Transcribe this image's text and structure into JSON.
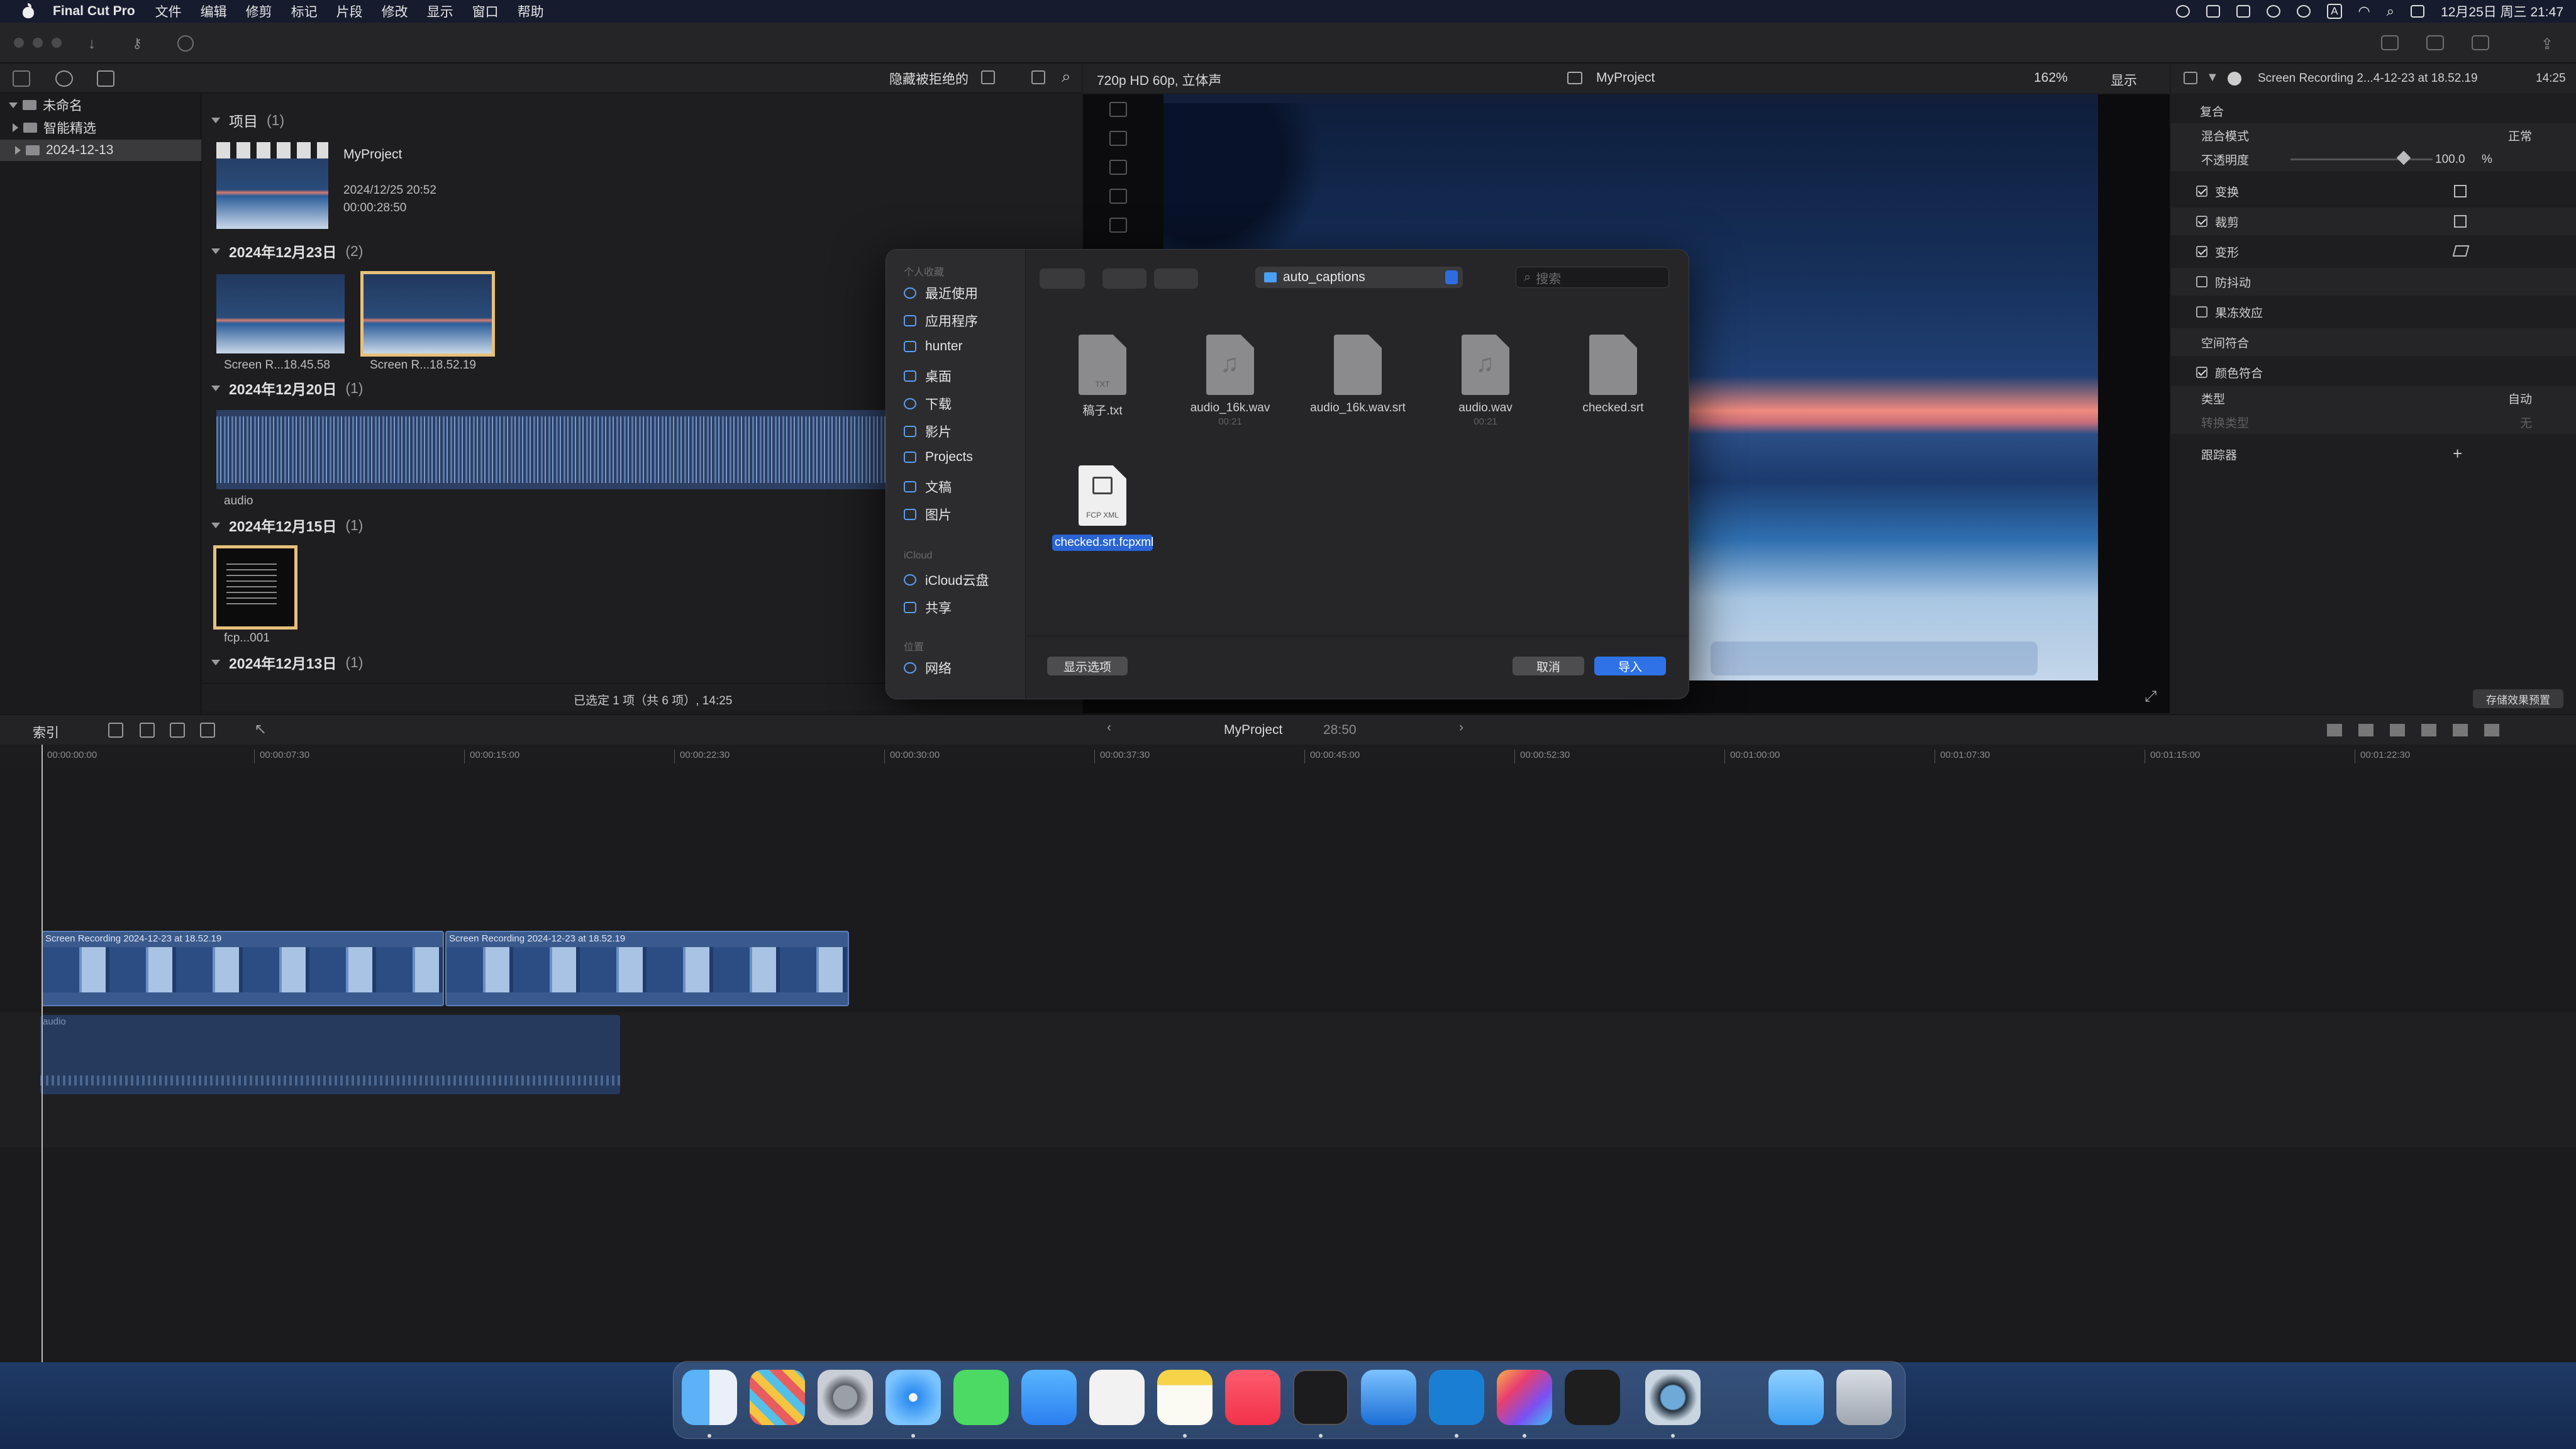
{
  "menubar": {
    "app": "Final Cut Pro",
    "items": [
      "文件",
      "编辑",
      "修剪",
      "标记",
      "片段",
      "修改",
      "显示",
      "窗口",
      "帮助"
    ],
    "datetime": "12月25日 周三 21:47",
    "input_badge": "A"
  },
  "library": {
    "root": "未命名",
    "smart": "智能精选",
    "event": "2024-12-13"
  },
  "browser": {
    "filter_label": "隐藏被拒绝的",
    "projects_header": "项目",
    "projects_count": "(1)",
    "project_name": "MyProject",
    "project_date": "2024/12/25 20:52",
    "project_duration": "00:00:28:50",
    "groups": [
      {
        "title": "2024年12月23日",
        "count": "(2)"
      },
      {
        "title": "2024年12月20日",
        "count": "(1)"
      },
      {
        "title": "2024年12月15日",
        "count": "(1)"
      },
      {
        "title": "2024年12月13日",
        "count": "(1)"
      }
    ],
    "clip1": "Screen R...18.45.58",
    "clip2": "Screen R...18.52.19",
    "audio_clip": "audio",
    "fcp_clip": "fcp...001",
    "footer": "已选定 1 项（共 6 项）, 14:25"
  },
  "viewer": {
    "format": "720p HD 60p, 立体声",
    "project": "MyProject",
    "zoom": "162%",
    "display": "显示"
  },
  "inspector": {
    "title": "Screen Recording 2...4-12-23 at 18.52.19",
    "timecode": "14:25",
    "section": "复合",
    "blend_label": "混合模式",
    "blend_value": "正常",
    "opacity_label": "不透明度",
    "opacity_value": "100.0",
    "opacity_unit": "%",
    "transform": "变换",
    "crop": "裁剪",
    "distort": "变形",
    "stabilize": "防抖动",
    "rolling": "果冻效应",
    "spatial": "空间符合",
    "color_conform": "颜色符合",
    "type_label": "类型",
    "type_value": "自动",
    "convert_label": "转换类型",
    "convert_value": "无",
    "tracker": "跟踪器",
    "save_preset": "存储效果预置"
  },
  "dialog": {
    "sec_personal": "个人收藏",
    "sidebar": [
      "最近使用",
      "应用程序",
      "hunter",
      "桌面",
      "下载",
      "影片",
      "Projects",
      "文稿",
      "图片"
    ],
    "sec_icloud": "iCloud",
    "icloud_items": [
      "iCloud云盘",
      "共享"
    ],
    "sec_location": "位置",
    "network": "网络",
    "path": "auto_captions",
    "search_placeholder": "搜索",
    "files": [
      {
        "name": "稿子.txt",
        "kind": "TXT",
        "sub": ""
      },
      {
        "name": "audio_16k.wav",
        "kind": "audio",
        "sub": "00:21"
      },
      {
        "name": "audio_16k.wav.srt",
        "kind": "",
        "sub": ""
      },
      {
        "name": "audio.wav",
        "kind": "audio",
        "sub": "00:21"
      },
      {
        "name": "checked.srt",
        "kind": "",
        "sub": ""
      }
    ],
    "selected_file": "checked.srt.fcpxml",
    "selected_kind": "FCP XML",
    "show_options": "显示选项",
    "cancel": "取消",
    "import": "导入"
  },
  "timeline": {
    "index": "索引",
    "project": "MyProject",
    "duration": "28:50",
    "ruler": [
      "00:00:00:00",
      "00:00:07:30",
      "00:00:15:00",
      "00:00:22:30",
      "00:00:30:00",
      "00:00:37:30",
      "00:00:45:00",
      "00:00:52:30",
      "00:01:00:00",
      "00:01:07:30",
      "00:01:15:00",
      "00:01:22:30"
    ],
    "clip_a": "Screen Recording 2024-12-23 at 18.52.19",
    "clip_b": "Screen Recording 2024-12-23 at 18.52.19",
    "audio": "audio"
  },
  "dock": [
    "finder",
    "launchpad",
    "system-settings",
    "safari",
    "messages",
    "mail",
    "reminders",
    "notes",
    "music",
    "terminal",
    "xcode",
    "vscode",
    "final-cut-pro",
    "figma",
    "quicktime",
    "folder",
    "trash"
  ],
  "colors": {
    "accent": "#2f72e8",
    "selection": "#e6c07a",
    "menubar": "#161b2e"
  }
}
